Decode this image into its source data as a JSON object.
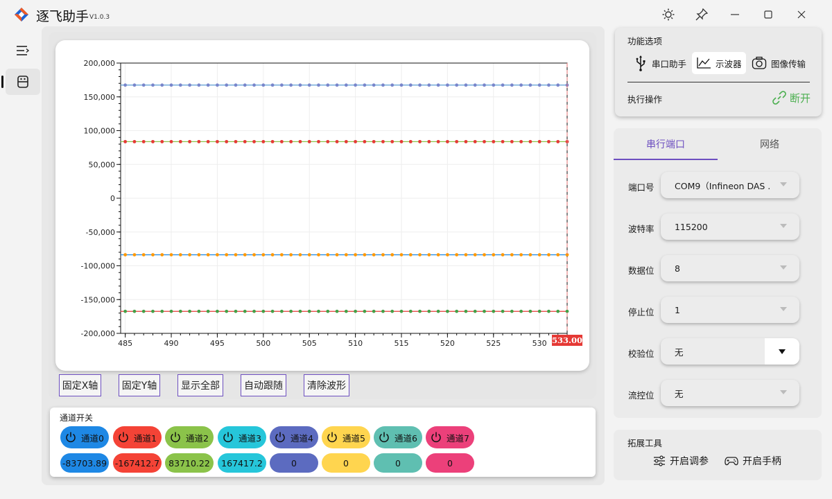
{
  "app": {
    "title": "逐飞助手",
    "version": "V1.0.3"
  },
  "plot_buttons": [
    "固定X轴",
    "固定Y轴",
    "显示全部",
    "自动跟随",
    "清除波形"
  ],
  "channels": {
    "title": "通道开关",
    "items": [
      {
        "label": "通道0",
        "value": "-83703.89",
        "color": "#1e88e5",
        "value_color": "#1e88e5"
      },
      {
        "label": "通道1",
        "value": "-167412.7",
        "color": "#f44336",
        "value_color": "#f44336"
      },
      {
        "label": "通道2",
        "value": "83710.22",
        "color": "#8bc34a",
        "value_color": "#8bc34a"
      },
      {
        "label": "通道3",
        "value": "167417.2",
        "color": "#26c6da",
        "value_color": "#26c6da"
      },
      {
        "label": "通道4",
        "value": "0",
        "color": "#5c6bc0",
        "value_color": "#5c6bc0"
      },
      {
        "label": "通道5",
        "value": "0",
        "color": "#ffd54f",
        "value_color": "#ffd54f"
      },
      {
        "label": "通道6",
        "value": "0",
        "color": "#5fbfb1",
        "value_color": "#5fbfb1"
      },
      {
        "label": "通道7",
        "value": "0",
        "color": "#ec407a",
        "value_color": "#ec407a"
      }
    ]
  },
  "func": {
    "title": "功能选项",
    "tabs": [
      "串口助手",
      "示波器",
      "图像传输"
    ],
    "exec_label": "执行操作",
    "disconnect_label": "断开"
  },
  "serial": {
    "tabs": [
      "串行端口",
      "网络"
    ],
    "fields": [
      {
        "label": "端口号",
        "value": "COM9（Infineon DAS ."
      },
      {
        "label": "波特率",
        "value": "115200"
      },
      {
        "label": "数据位",
        "value": "8"
      },
      {
        "label": "停止位",
        "value": "1"
      },
      {
        "label": "校验位",
        "value": "无"
      },
      {
        "label": "流控位",
        "value": "无"
      }
    ]
  },
  "ext": {
    "title": "拓展工具",
    "tune_label": "开启调参",
    "gamepad_label": "开启手柄"
  },
  "chart_data": {
    "type": "line",
    "xlim": [
      484.5,
      533
    ],
    "ylim": [
      -200000,
      200000
    ],
    "x_ticks": [
      485,
      490,
      495,
      500,
      505,
      510,
      515,
      520,
      525,
      530
    ],
    "y_ticks": [
      200000,
      150000,
      100000,
      50000,
      0,
      -50000,
      -100000,
      -150000,
      -200000
    ],
    "y_tick_labels": [
      "200,000",
      "150,000",
      "100,000",
      "50,000",
      "0",
      "-50,000",
      "-100,000",
      "-150,000",
      "-200,000"
    ],
    "cursor_x": 533.0,
    "cursor_label": "533.00",
    "x_start": 485,
    "x_end": 533,
    "grid": true,
    "series": [
      {
        "values_constant": 167417.2,
        "color": "#5a9bd5",
        "marker_color": "#7986cb"
      },
      {
        "values_constant": 83710.22,
        "color": "#8bc34a",
        "marker_color": "#e53935"
      },
      {
        "values_constant": -83703.89,
        "color": "#1e88e5",
        "marker_color": "#ff9800"
      },
      {
        "values_constant": -167412.7,
        "color": "#e53935",
        "marker_color": "#43a047"
      }
    ]
  }
}
